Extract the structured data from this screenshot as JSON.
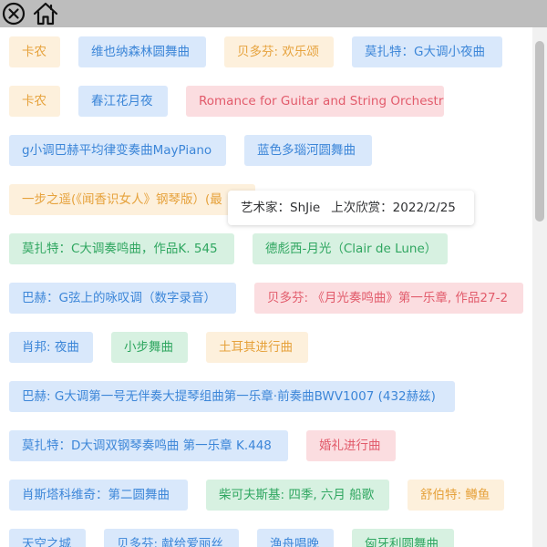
{
  "toolbar": {
    "close_icon": "close-icon",
    "home_icon": "home-icon"
  },
  "tags": [
    {
      "label": "卡农",
      "color": "orange"
    },
    {
      "label": "维也纳森林圆舞曲",
      "color": "blue"
    },
    {
      "label": "贝多芬: 欢乐颂",
      "color": "orange"
    },
    {
      "label": "莫扎特：G大调小夜曲",
      "color": "blue"
    },
    {
      "label": "卡农",
      "color": "orange"
    },
    {
      "label": "春江花月夜",
      "color": "blue"
    },
    {
      "label": "Romance for Guitar and String Orchestra",
      "color": "red"
    },
    {
      "label": "g小调巴赫平均律变奏曲MayPiano",
      "color": "blue"
    },
    {
      "label": "蓝色多瑙河圆舞曲",
      "color": "blue"
    },
    {
      "label": "一步之遥(《闻香识女人》钢琴版）(最",
      "color": "orange"
    },
    {
      "label": "莫扎特：C大调奏鸣曲，作品K. 545",
      "color": "green"
    },
    {
      "label": "德彪西-月光（Clair de Lune）",
      "color": "green"
    },
    {
      "label": "巴赫：G弦上的咏叹调（数字录音）",
      "color": "blue"
    },
    {
      "label": "贝多芬: 《月光奏鸣曲》第一乐章, 作品27-2",
      "color": "red"
    },
    {
      "label": "肖邦: 夜曲",
      "color": "blue"
    },
    {
      "label": "小步舞曲",
      "color": "green"
    },
    {
      "label": "土耳其进行曲",
      "color": "orange"
    },
    {
      "label": "巴赫: G大调第一号无伴奏大提琴组曲第一乐章·前奏曲BWV1007 (432赫兹)",
      "color": "blue"
    },
    {
      "label": "莫扎特：D大调双钢琴奏鸣曲 第一乐章 K.448",
      "color": "blue"
    },
    {
      "label": "婚礼进行曲",
      "color": "red"
    },
    {
      "label": "肖斯塔科维奇：第二圆舞曲",
      "color": "blue"
    },
    {
      "label": "柴可夫斯基: 四季, 六月 船歌",
      "color": "green"
    },
    {
      "label": "舒伯特: 鳟鱼",
      "color": "orange"
    },
    {
      "label": "天空之城",
      "color": "blue"
    },
    {
      "label": "贝多芬: 献给爱丽丝",
      "color": "blue"
    },
    {
      "label": "渔舟唱晚",
      "color": "blue"
    },
    {
      "label": "匈牙利圆舞曲",
      "color": "green"
    }
  ],
  "tooltip": {
    "artist_label": "艺术家：",
    "artist": "ShJie",
    "last_label": "上次欣赏：",
    "last_date": "2022/2/25"
  }
}
